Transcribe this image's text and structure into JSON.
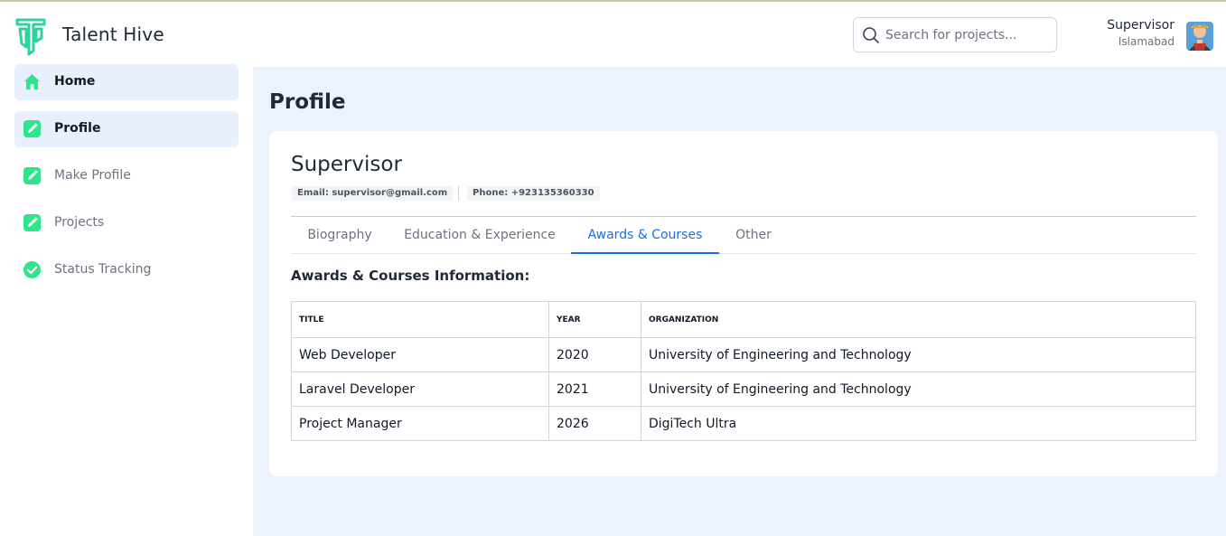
{
  "app": {
    "name": "Talent Hive"
  },
  "search": {
    "placeholder": "Search for projects..."
  },
  "user": {
    "name": "Supervisor",
    "location": "Islamabad"
  },
  "sidebar": {
    "items": [
      {
        "label": "Home",
        "icon": "home-icon",
        "active": true
      },
      {
        "label": "Profile",
        "icon": "edit-icon",
        "active": true
      },
      {
        "label": "Make Profile",
        "icon": "edit-icon",
        "active": false
      },
      {
        "label": "Projects",
        "icon": "edit-icon",
        "active": false
      },
      {
        "label": "Status Tracking",
        "icon": "check-circle-icon",
        "active": false
      }
    ]
  },
  "page": {
    "title": "Profile"
  },
  "profile": {
    "name": "Supervisor",
    "email": "Email: supervisor@gmail.com",
    "phone": "Phone: +923135360330"
  },
  "tabs": [
    {
      "label": "Biography"
    },
    {
      "label": "Education & Experience"
    },
    {
      "label": "Awards & Courses",
      "active": true
    },
    {
      "label": "Other"
    }
  ],
  "awards": {
    "section_title": "Awards & Courses Information:",
    "columns": [
      "TITLE",
      "YEAR",
      "ORGANIZATION"
    ],
    "rows": [
      [
        "Web Developer",
        "2020",
        "University of Engineering and Technology"
      ],
      [
        "Laravel Developer",
        "2021",
        "University of Engineering and Technology"
      ],
      [
        "Project Manager",
        "2026",
        "DigiTech Ultra"
      ]
    ]
  },
  "colors": {
    "accent": "#2ee58a",
    "tab_active": "#1d6ee6",
    "main_bg": "#edf3fd",
    "active_nav_bg": "#e8f0fd"
  }
}
